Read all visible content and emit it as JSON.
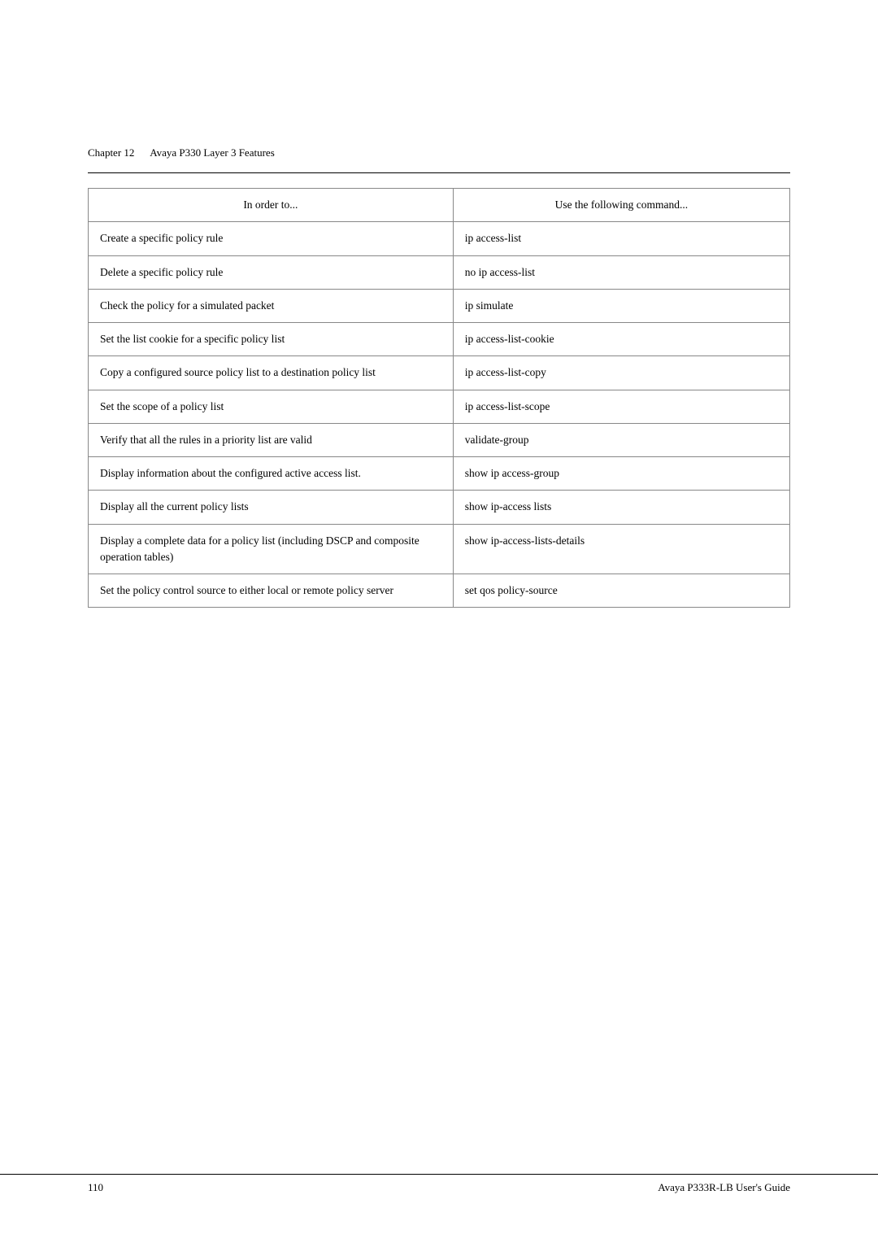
{
  "header": {
    "chapter": "Chapter 12",
    "title": "Avaya P330 Layer 3 Features"
  },
  "table": {
    "col1_header": "In order to...",
    "col2_header": "Use the following command...",
    "rows": [
      {
        "description": "Create a specific policy rule",
        "command": "ip access-list"
      },
      {
        "description": "Delete a specific policy rule",
        "command": "no ip access-list"
      },
      {
        "description": "Check the policy for a simulated packet",
        "command": "ip simulate"
      },
      {
        "description": "Set the list cookie for a specific policy list",
        "command": "ip access-list-cookie"
      },
      {
        "description": "Copy a configured source policy list to a destination policy list",
        "command": "ip access-list-copy"
      },
      {
        "description": "Set the scope of a policy list",
        "command": "ip access-list-scope"
      },
      {
        "description": "Verify that all the rules in a priority list are valid",
        "command": "validate-group"
      },
      {
        "description": "Display information about the configured active access list.",
        "command": "show ip access-group"
      },
      {
        "description": "Display all the current policy lists",
        "command": "show ip-access lists"
      },
      {
        "description": "Display a complete data for a policy list (including DSCP and composite operation tables)",
        "command": "show ip-access-lists-details"
      },
      {
        "description": "Set the policy control source to either local or remote policy server",
        "command": "set qos policy-source"
      }
    ]
  },
  "footer": {
    "page_number": "110",
    "guide_title": "Avaya P333R-LB User's Guide"
  }
}
